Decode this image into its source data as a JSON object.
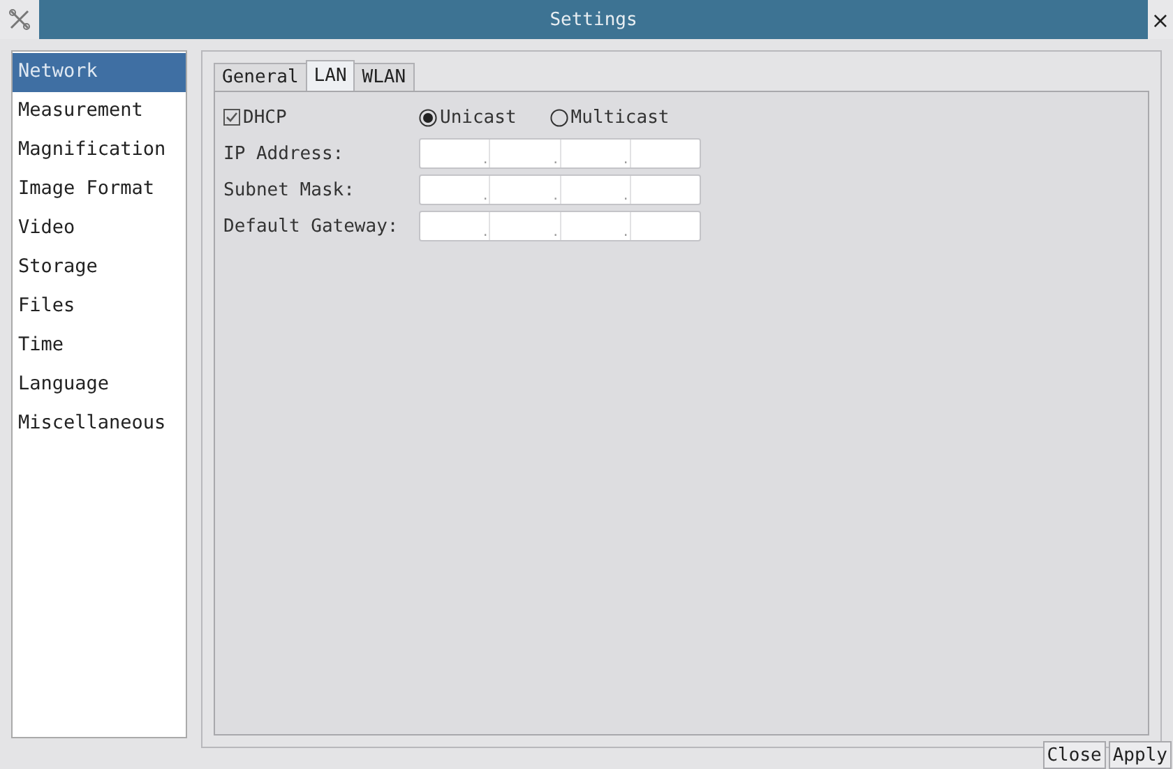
{
  "window": {
    "title": "Settings",
    "close": "×"
  },
  "sidebar": {
    "items": [
      {
        "label": "Network",
        "selected": true
      },
      {
        "label": "Measurement",
        "selected": false
      },
      {
        "label": "Magnification",
        "selected": false
      },
      {
        "label": "Image Format",
        "selected": false
      },
      {
        "label": "Video",
        "selected": false
      },
      {
        "label": "Storage",
        "selected": false
      },
      {
        "label": "Files",
        "selected": false
      },
      {
        "label": "Time",
        "selected": false
      },
      {
        "label": "Language",
        "selected": false
      },
      {
        "label": "Miscellaneous",
        "selected": false
      }
    ]
  },
  "tabs": [
    {
      "label": "General",
      "selected": false
    },
    {
      "label": "LAN",
      "selected": true
    },
    {
      "label": "WLAN",
      "selected": false
    }
  ],
  "dhcp": {
    "label": "DHCP",
    "checked": true
  },
  "modes": [
    {
      "label": "Unicast",
      "selected": true
    },
    {
      "label": "Multicast",
      "selected": false
    }
  ],
  "address_fields": [
    {
      "label": "IP Address:",
      "separator": "."
    },
    {
      "label": "Subnet Mask:",
      "separator": "."
    },
    {
      "label": "Default Gateway:",
      "separator": "."
    }
  ],
  "buttons": [
    "Close",
    "Apply"
  ]
}
